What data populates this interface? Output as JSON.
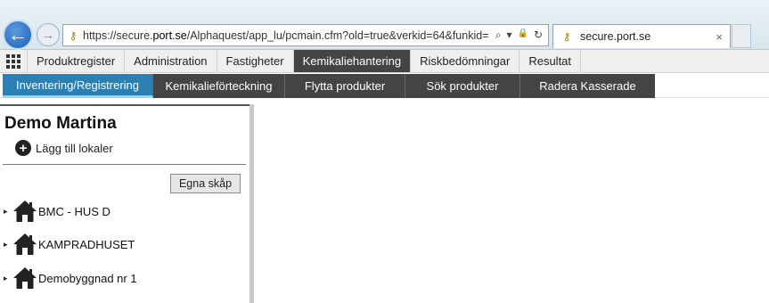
{
  "browser": {
    "url_prefix": "https://secure.",
    "url_domain": "port.se",
    "url_rest": "/Alphaquest/app_lu/pcmain.cfm?old=true&verkid=64&funkid=",
    "tab_title": "secure.port.se",
    "tab_close": "×",
    "back_glyph": "←",
    "forward_glyph": "→",
    "search_glyph": "⌕",
    "dropdown_glyph": "▾",
    "lock_glyph": "🔒",
    "refresh_glyph": "↻",
    "key_glyph": "⚷"
  },
  "main_menu": {
    "items": [
      {
        "label": "Produktregister"
      },
      {
        "label": "Administration"
      },
      {
        "label": "Fastigheter"
      },
      {
        "label": "Kemikaliehantering",
        "active": true
      },
      {
        "label": "Riskbedömningar"
      },
      {
        "label": "Resultat"
      }
    ]
  },
  "sub_menu": {
    "items": [
      {
        "label": "Inventering/Registrering",
        "active": true
      },
      {
        "label": "Kemikalieförteckning"
      },
      {
        "label": "Flytta produkter"
      },
      {
        "label": "Sök produkter"
      },
      {
        "label": "Radera Kasserade"
      }
    ]
  },
  "left_panel": {
    "company": "Demo Martina",
    "add_room_label": "Lägg till lokaler",
    "add_room_glyph": "+",
    "own_cabinets_button": "Egna skåp",
    "buildings": [
      {
        "label": "BMC - HUS D"
      },
      {
        "label": "KAMPRADHUSET"
      },
      {
        "label": "Demobyggnad nr 1"
      }
    ],
    "caret_glyph": "▸"
  }
}
